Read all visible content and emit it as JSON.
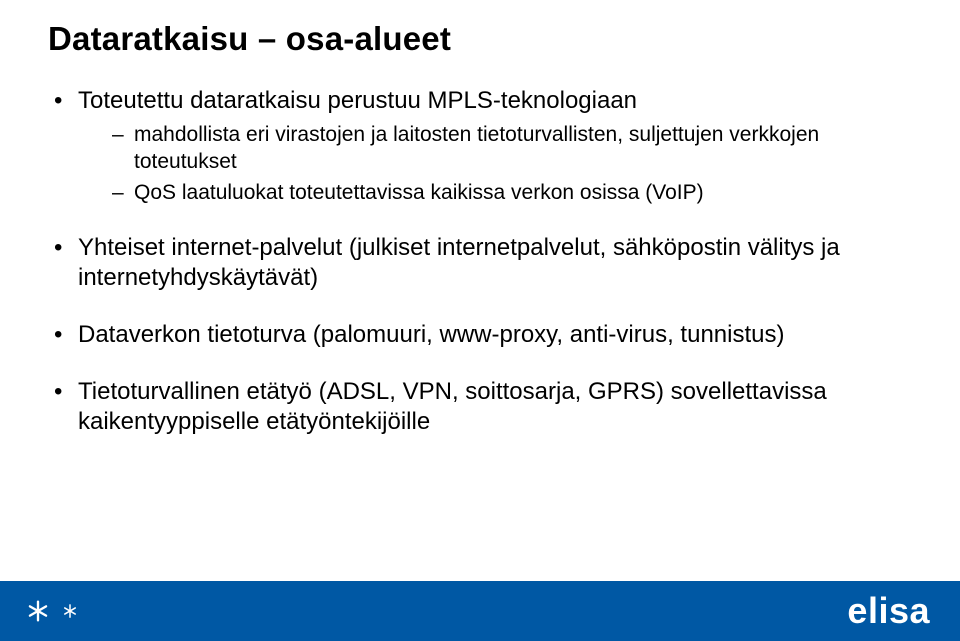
{
  "title": "Dataratkaisu – osa-alueet",
  "bullets": [
    {
      "text": "Toteutettu dataratkaisu perustuu MPLS-teknologiaan",
      "sub": [
        "mahdollista eri virastojen ja laitosten tietoturvallisten, suljettujen verkkojen toteutukset",
        "QoS laatuluokat toteutettavissa kaikissa verkon osissa (VoIP)"
      ]
    },
    {
      "text": "Yhteiset internet-palvelut (julkiset internetpalvelut, sähköpostin välitys ja internetyhdyskäytävät)",
      "sub": []
    },
    {
      "text": "Dataverkon tietoturva (palomuuri, www-proxy, anti-virus, tunnistus)",
      "sub": []
    },
    {
      "text": "Tietoturvallinen etätyö (ADSL, VPN, soittosarja, GPRS) sovellettavissa kaikentyyppiselle etätyöntekijöille",
      "sub": []
    }
  ],
  "footer": {
    "brand": "elisa",
    "color": "#0058a4"
  }
}
